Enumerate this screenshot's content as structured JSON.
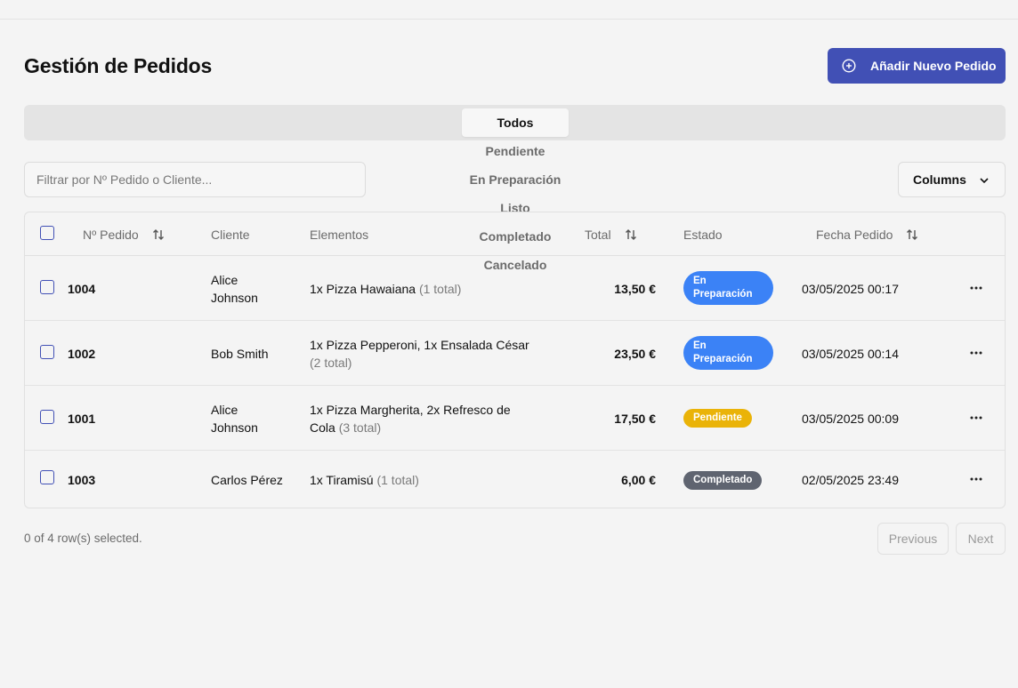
{
  "header": {
    "title": "Gestión de Pedidos",
    "add_button_label": "Añadir Nuevo Pedido"
  },
  "tabs": [
    {
      "label": "Todos",
      "active": true
    },
    {
      "label": "Pendiente"
    },
    {
      "label": "En Preparación"
    },
    {
      "label": "Listo"
    },
    {
      "label": "Completado"
    },
    {
      "label": "Cancelado"
    }
  ],
  "filter": {
    "placeholder": "Filtrar por Nº Pedido o Cliente...",
    "value": ""
  },
  "columns_button_label": "Columns",
  "table": {
    "headers": {
      "order_no": "Nº Pedido",
      "client": "Cliente",
      "items": "Elementos",
      "total": "Total",
      "status": "Estado",
      "date": "Fecha Pedido"
    },
    "rows": [
      {
        "id": "1004",
        "client": "Alice Johnson",
        "items": "1x Pizza Hawaiana",
        "items_count": "(1 total)",
        "total": "13,50 €",
        "status": "En Preparación",
        "date": "03/05/2025 00:17"
      },
      {
        "id": "1002",
        "client": "Bob Smith",
        "items": "1x Pizza Pepperoni, 1x Ensalada César",
        "items_count": "(2 total)",
        "total": "23,50 €",
        "status": "En Preparación",
        "date": "03/05/2025 00:14"
      },
      {
        "id": "1001",
        "client": "Alice Johnson",
        "items": "1x Pizza Margherita, 2x Refresco de Cola",
        "items_count": "(3 total)",
        "total": "17,50 €",
        "status": "Pendiente",
        "date": "03/05/2025 00:09"
      },
      {
        "id": "1003",
        "client": "Carlos Pérez",
        "items": "1x Tiramisú",
        "items_count": "(1 total)",
        "total": "6,00 €",
        "status": "Completado",
        "date": "02/05/2025 23:49"
      }
    ]
  },
  "footer": {
    "selection_text": "0 of 4 row(s) selected.",
    "previous_label": "Previous",
    "next_label": "Next"
  },
  "colors": {
    "accent": "#4150b5",
    "status_preparing": "#3b82f6",
    "status_pending": "#eab308",
    "status_completed": "#5f6470"
  }
}
